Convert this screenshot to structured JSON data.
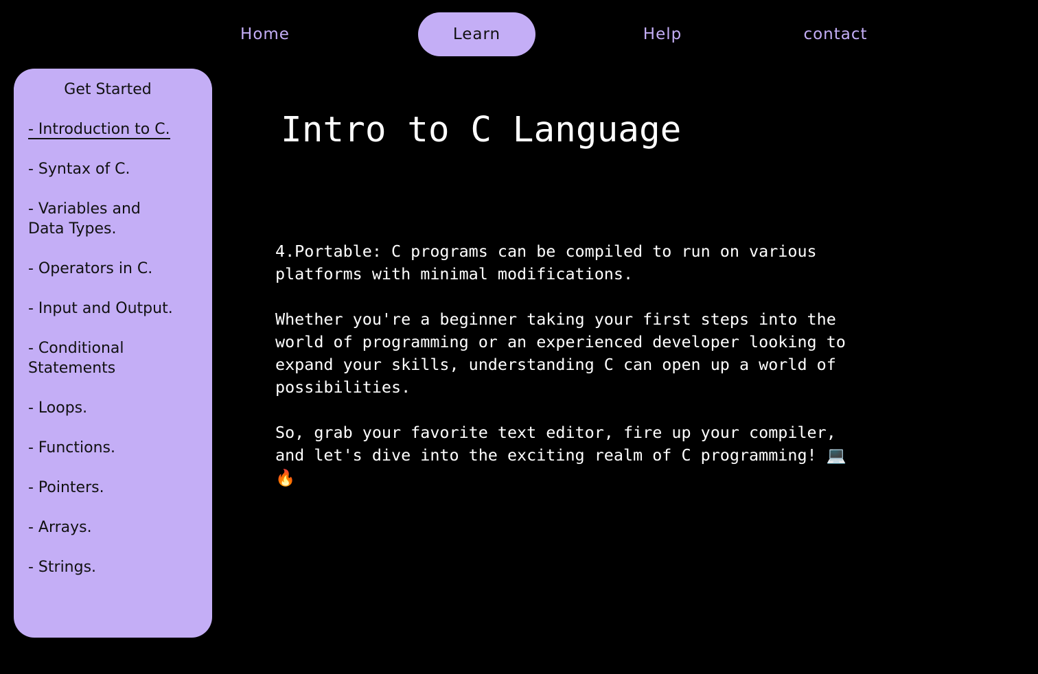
{
  "nav": {
    "home": "Home",
    "learn": "Learn",
    "help": "Help",
    "contact": "contact"
  },
  "sidebar": {
    "title": "Get Started",
    "items": [
      {
        "label": "- Introduction to C."
      },
      {
        "label": "- Syntax of C."
      },
      {
        "label": "- Variables and Data Types."
      },
      {
        "label": "- Operators in C."
      },
      {
        "label": "- Input and Output."
      },
      {
        "label": "- Conditional Statements"
      },
      {
        "label": "- Loops."
      },
      {
        "label": "- Functions."
      },
      {
        "label": "- Pointers."
      },
      {
        "label": "- Arrays."
      },
      {
        "label": "- Strings."
      }
    ]
  },
  "main": {
    "title": "Intro to C Language",
    "paragraphs": [
      "4.Portable: C programs can be compiled to run on various platforms with minimal modifications.",
      "Whether you're a beginner taking your first steps into the world of programming or an experienced developer looking to expand your skills, understanding C can open up a world of possibilities.",
      "So, grab your favorite text editor, fire up your compiler, and let's dive into the exciting realm of C programming! 💻🔥"
    ]
  },
  "colors": {
    "background": "#000000",
    "accent": "#c4aef6",
    "text": "#ffffff",
    "dark_text": "#111111"
  }
}
